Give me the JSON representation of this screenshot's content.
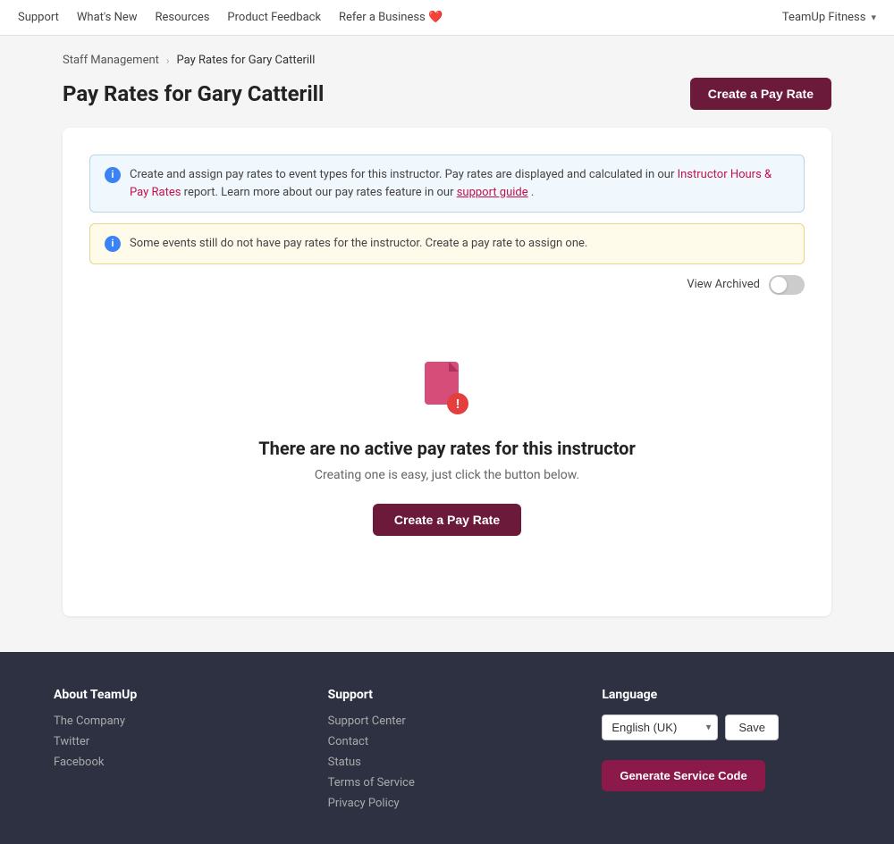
{
  "topnav": {
    "links": [
      {
        "label": "Support",
        "href": "#"
      },
      {
        "label": "What's New",
        "href": "#"
      },
      {
        "label": "Resources",
        "href": "#"
      },
      {
        "label": "Product Feedback",
        "href": "#"
      },
      {
        "label": "Refer a Business",
        "href": "#"
      }
    ],
    "user": "TeamUp Fitness"
  },
  "breadcrumb": {
    "parent": "Staff Management",
    "current": "Pay Rates for Gary Catterill"
  },
  "page": {
    "title": "Pay Rates for Gary Catterill",
    "create_button": "Create a Pay Rate"
  },
  "info_box_1": {
    "text_before": "Create and assign pay rates to event types for this instructor. Pay rates are displayed and calculated in our ",
    "link_text": "Instructor Hours & Pay Rates",
    "text_middle": " report. Learn more about our pay rates feature in our ",
    "support_link": "support guide",
    "text_after": "."
  },
  "info_box_2": {
    "text": "Some events still do not have pay rates for the instructor. Create a pay rate to assign one."
  },
  "view_archived": {
    "label": "View Archived"
  },
  "empty_state": {
    "title": "There are no active pay rates for this instructor",
    "subtitle": "Creating one is easy, just click the button below.",
    "button": "Create a Pay Rate"
  },
  "footer": {
    "about_title": "About TeamUp",
    "about_links": [
      {
        "label": "The Company"
      },
      {
        "label": "Twitter"
      },
      {
        "label": "Facebook"
      }
    ],
    "support_title": "Support",
    "support_links": [
      {
        "label": "Support Center"
      },
      {
        "label": "Contact"
      },
      {
        "label": "Status"
      },
      {
        "label": "Terms of Service"
      },
      {
        "label": "Privacy Policy"
      }
    ],
    "language_title": "Language",
    "language_value": "English (UK)",
    "save_button": "Save",
    "generate_button": "Generate Service Code"
  }
}
